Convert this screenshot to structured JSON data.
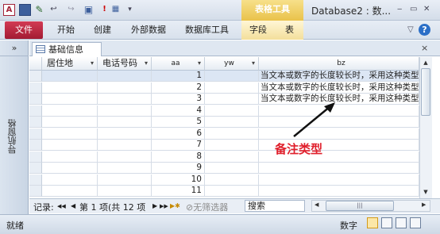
{
  "window": {
    "title": "Database2 : 数...",
    "context_tab_group": "表格工具",
    "controls": [
      "‒",
      "▭",
      "✕"
    ]
  },
  "quick_access": [
    "A",
    "💾",
    "↩",
    "↪",
    "!",
    "▦"
  ],
  "ribbon": {
    "file": "文件",
    "tabs": [
      "开始",
      "创建",
      "外部数据",
      "数据库工具",
      "字段",
      "表"
    ],
    "help": "?"
  },
  "nav_pane": {
    "toggle": "»",
    "label": "导航窗格"
  },
  "doc_tab": {
    "label": "基础信息",
    "close": "×"
  },
  "table": {
    "columns": [
      {
        "label": "居住地",
        "arrow": "▾"
      },
      {
        "label": "电话号码",
        "arrow": "▾"
      },
      {
        "label": "aa",
        "arrow": "▾"
      },
      {
        "label": "yw",
        "arrow": "▾"
      },
      {
        "label": "bz",
        "arrow": ""
      }
    ],
    "rows": [
      {
        "aa": "1",
        "bz": "当文本或数字的长度较长时，采用这种类型"
      },
      {
        "aa": "2",
        "bz": "当文本或数字的长度较长时，采用这种类型"
      },
      {
        "aa": "3",
        "bz": "当文本或数字的长度较长时，采用这种类型"
      },
      {
        "aa": "4",
        "bz": ""
      },
      {
        "aa": "5",
        "bz": ""
      },
      {
        "aa": "6",
        "bz": ""
      },
      {
        "aa": "7",
        "bz": ""
      },
      {
        "aa": "8",
        "bz": ""
      },
      {
        "aa": "9",
        "bz": ""
      },
      {
        "aa": "10",
        "bz": ""
      },
      {
        "aa": "11",
        "bz": ""
      }
    ]
  },
  "annotation": {
    "text": "备注类型"
  },
  "record_nav": {
    "label": "记录:",
    "first": "◀◀",
    "prev": "◀",
    "position": "第 1 项(共 12 项",
    "next": "▶",
    "last": "▶▶",
    "new": "▶✱",
    "filter": "无筛选器",
    "search": "搜索"
  },
  "status": {
    "left": "就绪",
    "mode": "数字"
  },
  "colors": {
    "file_tab": "#b7233d",
    "context": "#e9c24a",
    "annotation": "#e0202c"
  }
}
